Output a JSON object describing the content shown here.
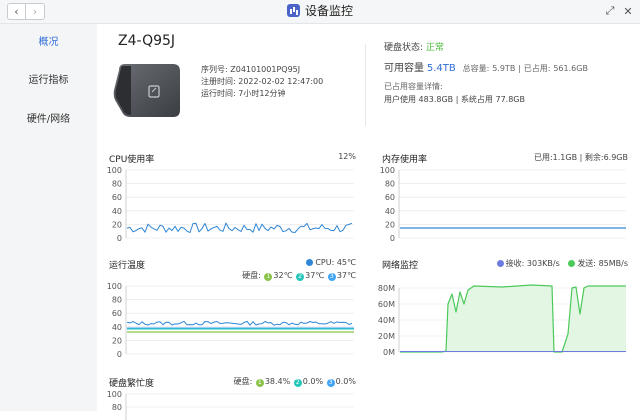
{
  "window": {
    "title": "设备监控",
    "back_glyph": "‹",
    "forward_glyph": "›",
    "close_glyph": "✕",
    "maximize_glyph": "⤢",
    "accent": "#2f6fd6"
  },
  "sidebar": {
    "items": [
      {
        "label": "概况",
        "active": true
      },
      {
        "label": "运行指标",
        "active": false
      },
      {
        "label": "硬件/网络",
        "active": false
      }
    ]
  },
  "device": {
    "name": "Z4-Q95J",
    "serial_label": "序列号:",
    "serial": "Z04101001PQ95J",
    "reg_label": "注册时间:",
    "reg_time": "2022-02-02 12:47:00",
    "uptime_label": "运行时间:",
    "uptime": "7小时12分钟"
  },
  "storage": {
    "status_label": "硬盘状态:",
    "status": "正常",
    "available_label": "可用容量",
    "available": "5.4TB",
    "total_label": "总容量:",
    "total": "5.9TB",
    "used_label": "已占用:",
    "used": "561.6GB",
    "detail_label": "已占用容量详情:",
    "user_label": "用户使用",
    "user_used": "483.8GB",
    "system_label": "系统占用",
    "system_used": "77.8GB",
    "status_color": "#4cba3c"
  },
  "cpu": {
    "title": "CPU使用率",
    "value": "12%",
    "y_ticks": [
      "100",
      "80",
      "60",
      "40",
      "20",
      "0"
    ],
    "color": "#2f86d6"
  },
  "memory": {
    "title": "内存使用率",
    "used_label": "已用:",
    "used": "1.1GB",
    "free_label": "剩余:",
    "free": "6.9GB",
    "y_ticks": [
      "100",
      "80",
      "60",
      "40",
      "20",
      "0"
    ],
    "color": "#2f86d6"
  },
  "temperature": {
    "title": "运行温度",
    "cpu_label": "CPU:",
    "cpu_value": "45℃",
    "disk_label": "硬盘:",
    "disks": [
      {
        "num": "1",
        "value": "32℃",
        "color": "#8bc34a"
      },
      {
        "num": "2",
        "value": "37℃",
        "color": "#26c6b9"
      },
      {
        "num": "3",
        "value": "37℃",
        "color": "#42a5f5"
      }
    ],
    "y_ticks": [
      "100",
      "80",
      "60",
      "40",
      "20",
      "0"
    ],
    "cpu_color": "#2f86d6"
  },
  "network": {
    "title": "网络监控",
    "rx_label": "接收:",
    "rx": "303KB/s",
    "tx_label": "发送:",
    "tx": "85MB/s",
    "y_ticks": [
      "80M",
      "60M",
      "40M",
      "20M",
      "0M"
    ],
    "rx_color": "#6c7be0",
    "tx_color": "#4cc95a"
  },
  "disk_busy": {
    "title": "硬盘繁忙度",
    "disk_label": "硬盘:",
    "disks": [
      {
        "num": "1",
        "value": "38.4%",
        "color": "#8bc34a"
      },
      {
        "num": "2",
        "value": "0.0%",
        "color": "#26c6b9"
      },
      {
        "num": "3",
        "value": "0.0%",
        "color": "#42a5f5"
      }
    ],
    "y_ticks": [
      "100",
      "80"
    ]
  }
}
